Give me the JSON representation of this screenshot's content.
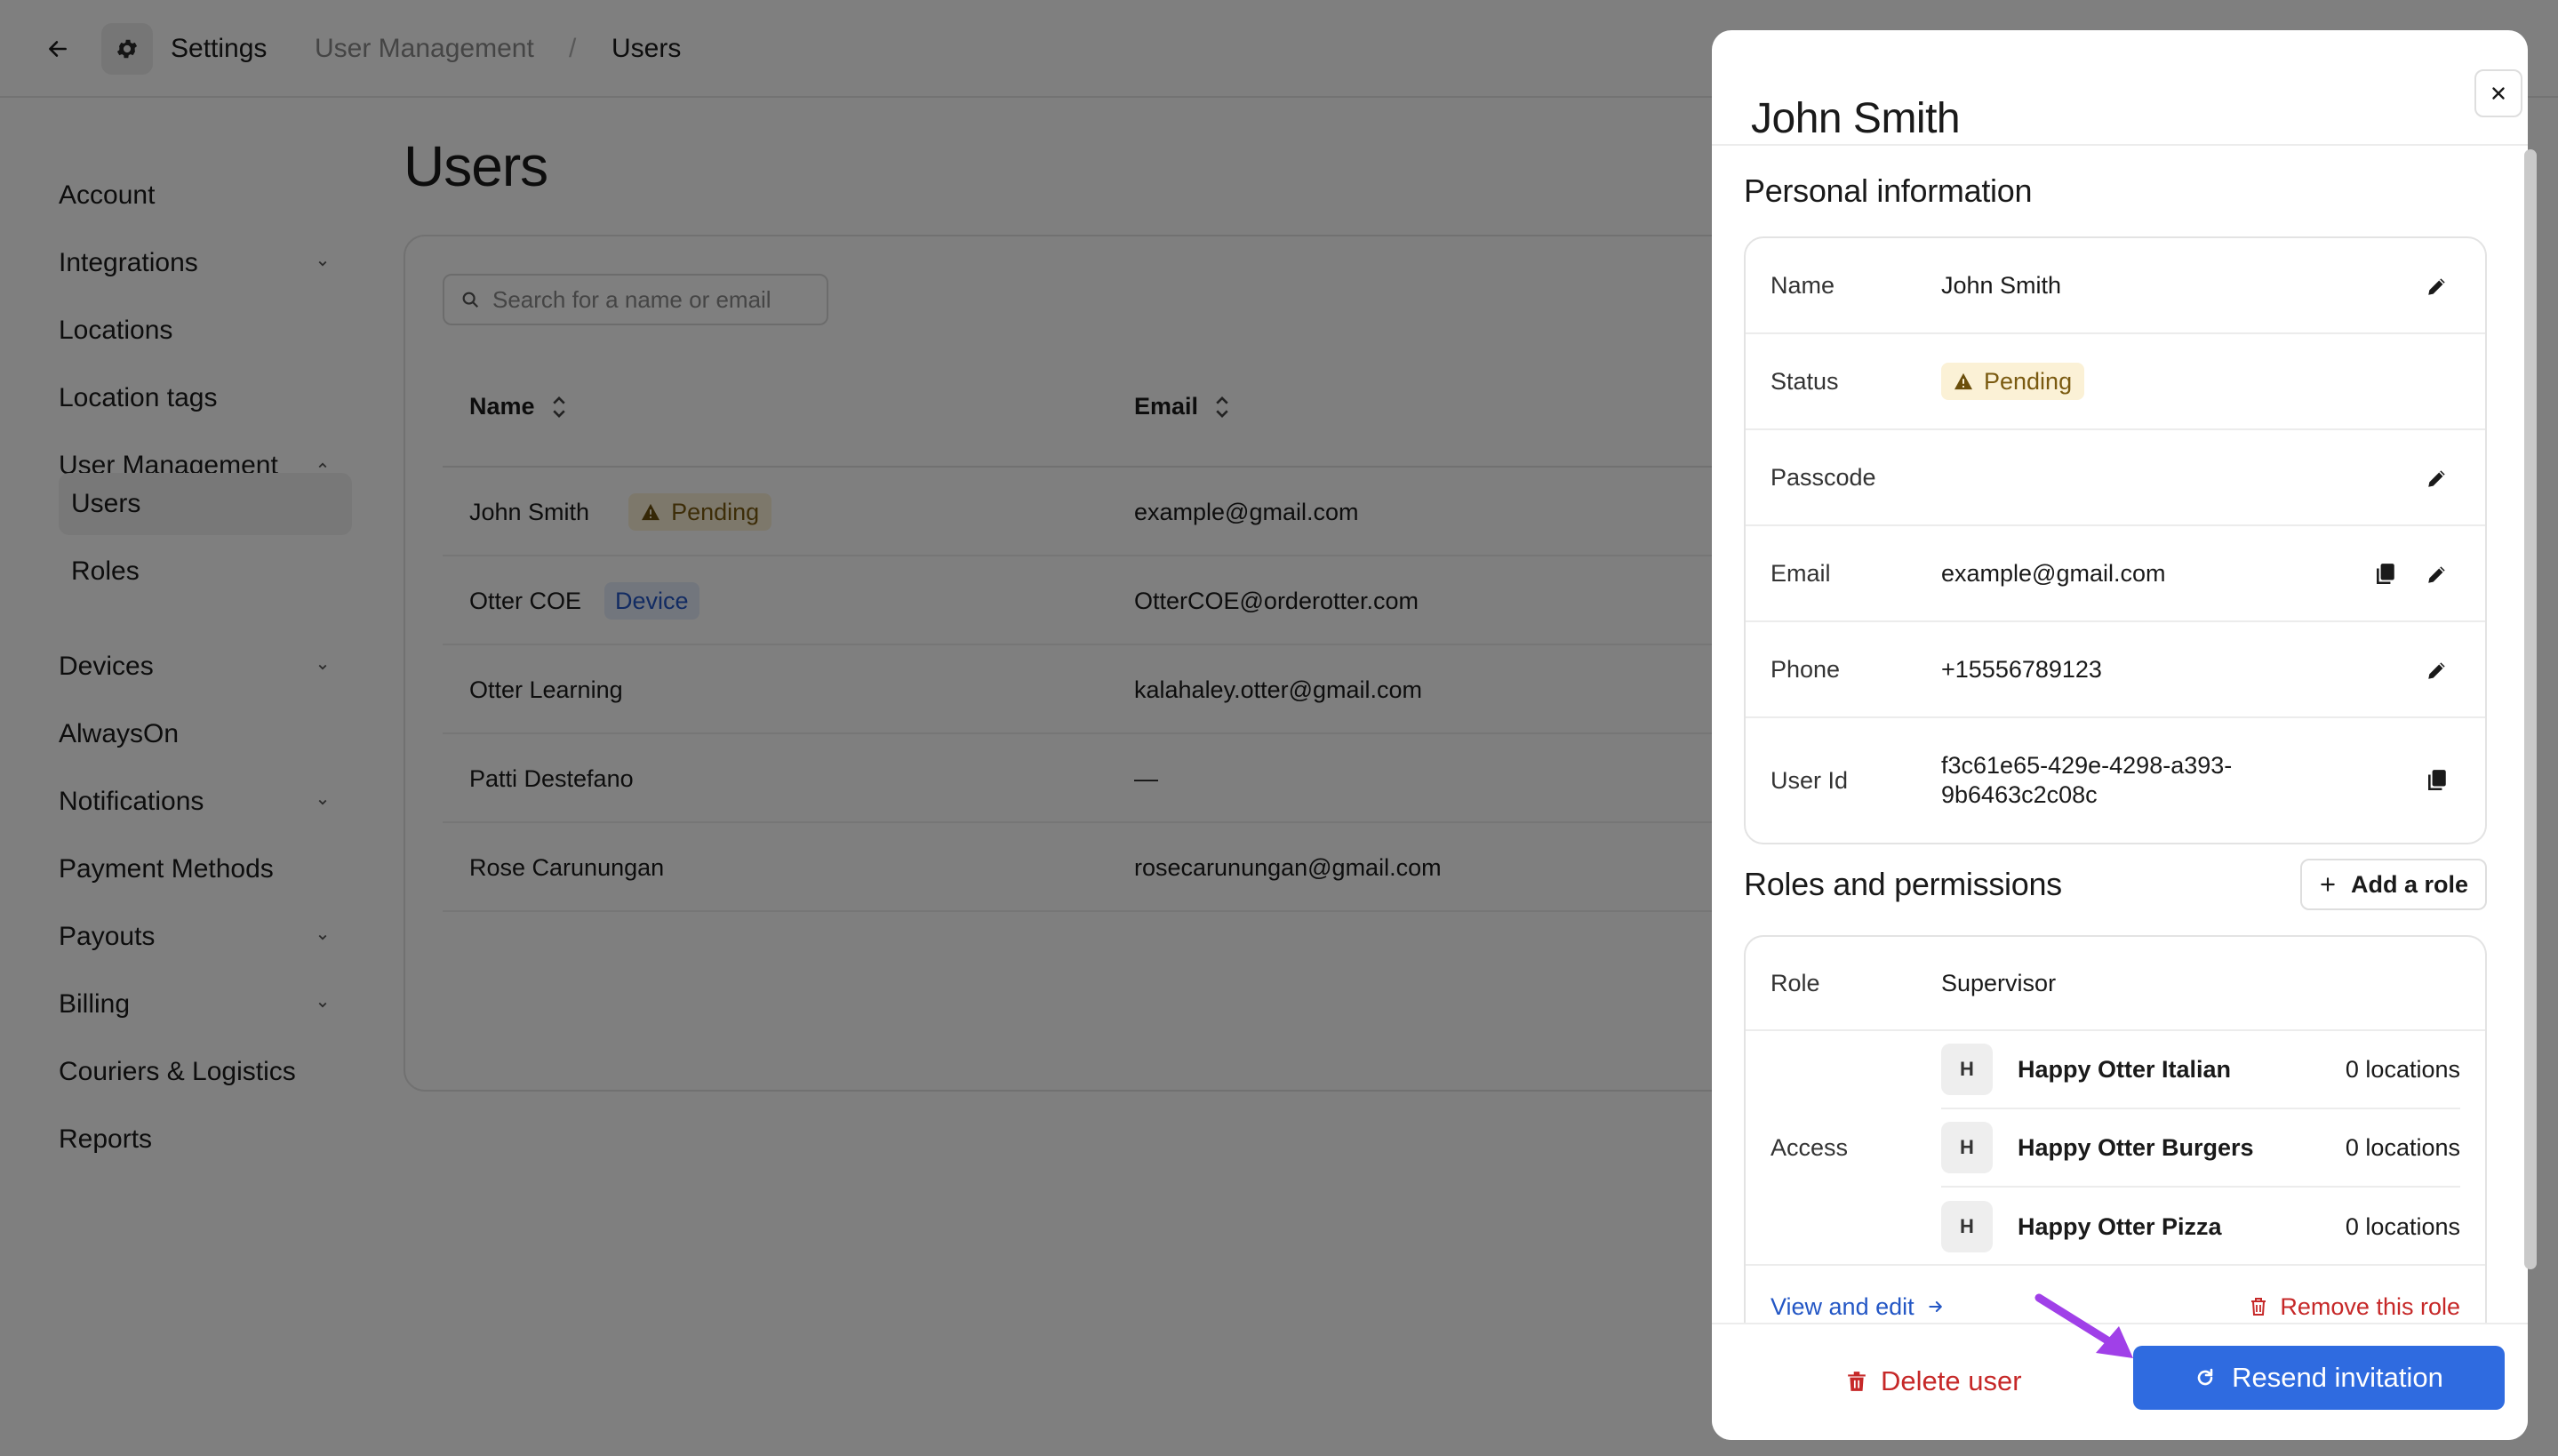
{
  "header": {
    "breadcrumb": [
      "Settings",
      "User Management",
      "/",
      "Users"
    ]
  },
  "sidebar": {
    "items": [
      {
        "label": "Account",
        "expandable": false
      },
      {
        "label": "Integrations",
        "expandable": true
      },
      {
        "label": "Locations",
        "expandable": false
      },
      {
        "label": "Location tags",
        "expandable": false
      },
      {
        "label": "User Management",
        "expandable": true,
        "expanded": true
      },
      {
        "label": "Devices",
        "expandable": true
      },
      {
        "label": "AlwaysOn",
        "expandable": false
      },
      {
        "label": "Notifications",
        "expandable": true
      },
      {
        "label": "Payment Methods",
        "expandable": false
      },
      {
        "label": "Payouts",
        "expandable": true
      },
      {
        "label": "Billing",
        "expandable": true
      },
      {
        "label": "Couriers & Logistics",
        "expandable": false
      },
      {
        "label": "Reports",
        "expandable": false
      }
    ],
    "subitems": [
      {
        "label": "Users",
        "active": true
      },
      {
        "label": "Roles",
        "active": false
      }
    ]
  },
  "main": {
    "title": "Users",
    "search_placeholder": "Search for a name or email",
    "columns": [
      "Name",
      "Email"
    ],
    "rows": [
      {
        "name": "John Smith",
        "badge": "Pending",
        "email": "example@gmail.com"
      },
      {
        "name": "Otter COE",
        "badge": "Device",
        "email": "OtterCOE@orderotter.com"
      },
      {
        "name": "Otter Learning",
        "badge": "",
        "email": "kalahaley.otter@gmail.com"
      },
      {
        "name": "Patti Destefano",
        "badge": "",
        "email": "—"
      },
      {
        "name": "Rose Carunungan",
        "badge": "",
        "email": "rosecarunungan@gmail.com"
      }
    ]
  },
  "drawer": {
    "title": "John Smith",
    "personal_title": "Personal information",
    "personal": {
      "name_label": "Name",
      "name_value": "John Smith",
      "status_label": "Status",
      "status_value": "Pending",
      "passcode_label": "Passcode",
      "passcode_value": "",
      "email_label": "Email",
      "email_value": "example@gmail.com",
      "phone_label": "Phone",
      "phone_value": "+15556789123",
      "userid_label": "User Id",
      "userid_line1": "f3c61e65-429e-4298-a393-",
      "userid_line2": "9b6463c2c08c"
    },
    "roles_title": "Roles and permissions",
    "add_role_label": "Add a role",
    "role_label": "Role",
    "role_value": "Supervisor",
    "access_label": "Access",
    "locations": [
      {
        "initial": "H",
        "name": "Happy Otter Italian",
        "count": "0 locations"
      },
      {
        "initial": "H",
        "name": "Happy Otter Burgers",
        "count": "0 locations"
      },
      {
        "initial": "H",
        "name": "Happy Otter Pizza",
        "count": "0 locations"
      }
    ],
    "view_edit_label": "View and edit",
    "remove_role_label": "Remove this role",
    "delete_user_label": "Delete user",
    "resend_label": "Resend invitation"
  },
  "colors": {
    "accent": "#2f6be0",
    "danger": "#c62828",
    "pending_bg": "#fbf1d6",
    "pending_fg": "#7a5a10",
    "device_bg": "#e4ecfb",
    "device_fg": "#2457c5",
    "annotation_arrow": "#a040e8"
  },
  "icons": {
    "back": "arrow-left-icon",
    "settings": "gear-icon",
    "search": "search-icon",
    "sort": "sort-icon",
    "chevron_down": "chevron-down-icon",
    "chevron_up": "chevron-up-icon",
    "close": "close-icon",
    "edit": "pencil-icon",
    "copy": "copy-icon",
    "warning": "warning-icon",
    "plus": "plus-icon",
    "arrow_right": "arrow-right-icon",
    "trash": "trash-icon",
    "refresh": "refresh-icon"
  }
}
